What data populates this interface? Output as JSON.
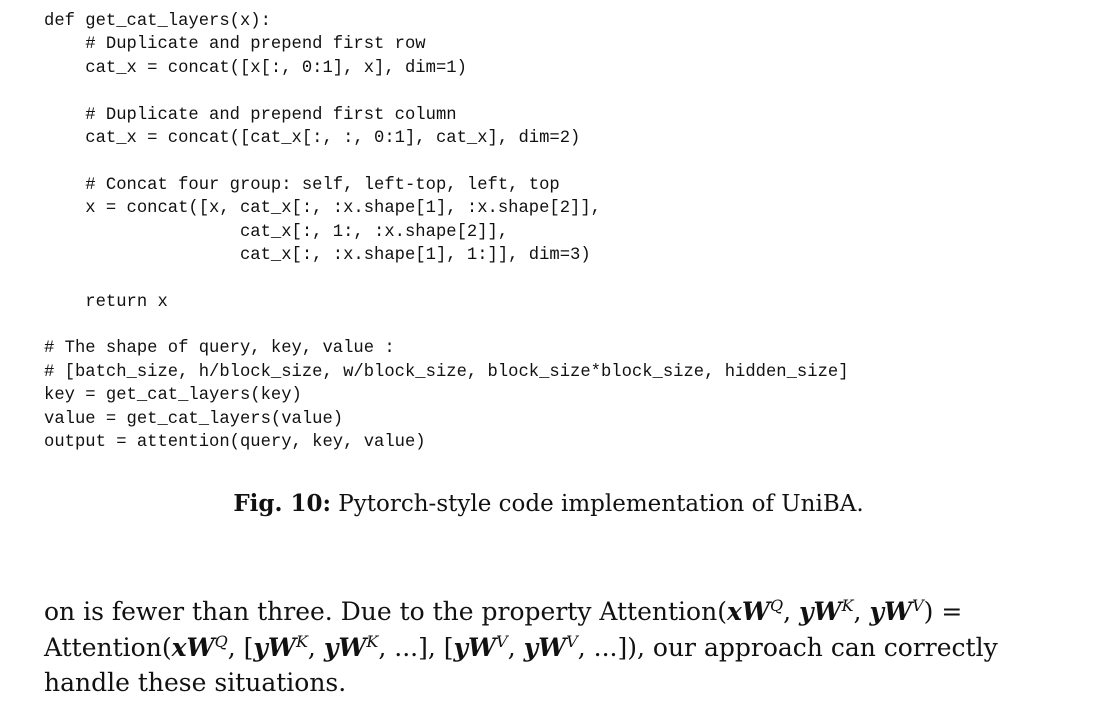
{
  "code_lines": [
    "def get_cat_layers(x):",
    "    # Duplicate and prepend first row",
    "    cat_x = concat([x[:, 0:1], x], dim=1)",
    "",
    "    # Duplicate and prepend first column",
    "    cat_x = concat([cat_x[:, :, 0:1], cat_x], dim=2)",
    "",
    "    # Concat four group: self, left-top, left, top",
    "    x = concat([x, cat_x[:, :x.shape[1], :x.shape[2]],",
    "                   cat_x[:, 1:, :x.shape[2]],",
    "                   cat_x[:, :x.shape[1], 1:]], dim=3)",
    "",
    "    return x",
    "",
    "# The shape of query, key, value :",
    "# [batch_size, h/block_size, w/block_size, block_size*block_size, hidden_size]",
    "key = get_cat_layers(key)",
    "value = get_cat_layers(value)",
    "output = attention(query, key, value)"
  ],
  "caption": {
    "label": "Fig. 10:",
    "text": " Pytorch-style code implementation of UniBA."
  },
  "paragraph": {
    "line1_text": "on is fewer than three. Due to the property",
    "attention_word": "Attention",
    "line3_text": "handle these situations.",
    "line2_tail": ", our approach can correctly"
  }
}
